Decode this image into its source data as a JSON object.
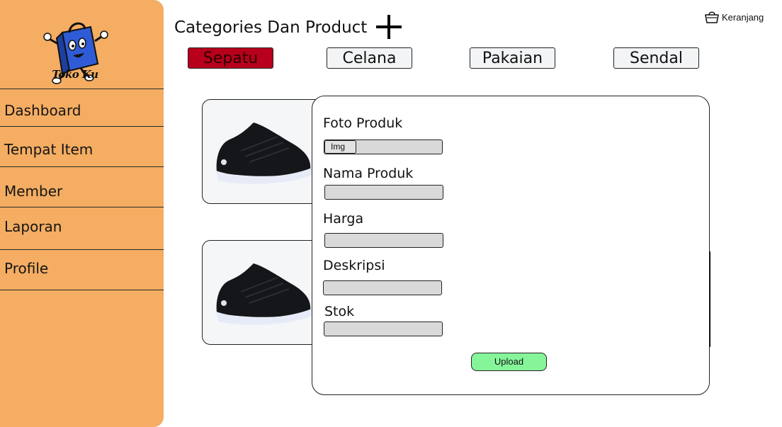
{
  "brand": {
    "logo_text": "Toko Ku"
  },
  "sidebar": {
    "items": [
      {
        "label": "Dashboard"
      },
      {
        "label": "Tempat Item"
      },
      {
        "label": "Member"
      },
      {
        "label": "Laporan"
      },
      {
        "label": "Profile"
      }
    ]
  },
  "header": {
    "title": "Categories Dan Product",
    "cart_label": "Keranjang"
  },
  "categories": {
    "tabs": [
      {
        "label": "Sepatu",
        "active": true
      },
      {
        "label": "Celana",
        "active": false
      },
      {
        "label": "Pakaian",
        "active": false
      },
      {
        "label": "Sendal",
        "active": false
      }
    ]
  },
  "products": [
    {
      "image": "black-sneaker"
    },
    {
      "image": "black-sneaker"
    }
  ],
  "form": {
    "photo_label": "Foto Produk",
    "photo_button": "Img",
    "name_label": "Nama Produk",
    "name_value": "",
    "price_label": "Harga",
    "price_value": "",
    "description_label": "Deskripsi",
    "description_value": "",
    "stock_label": "Stok",
    "stock_value": "",
    "upload_label": "Upload"
  },
  "colors": {
    "sidebar": "#f4ad62",
    "active_tab": "#b8001d",
    "upload_button": "#86f59a",
    "input_fill": "#d9d9d9"
  }
}
